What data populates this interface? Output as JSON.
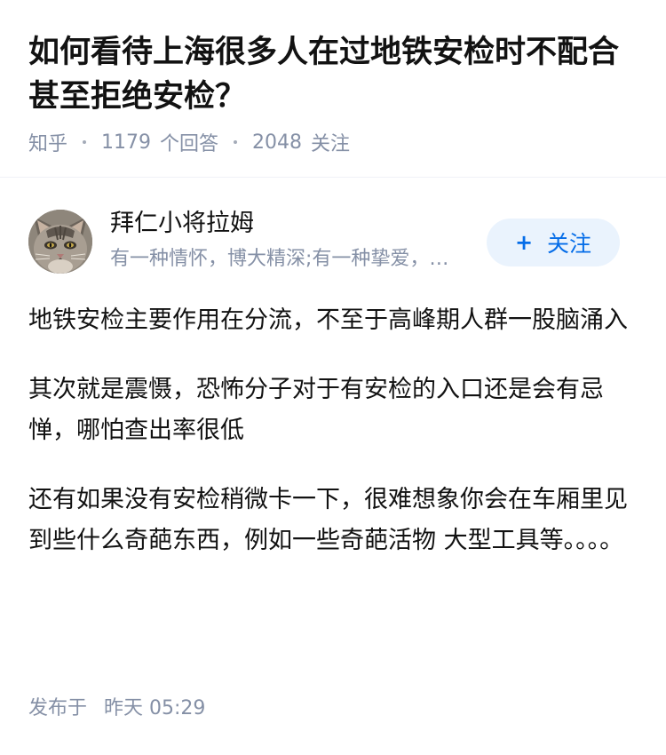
{
  "question": {
    "title": "如何看待上海很多人在过地铁安检时不配合甚至拒绝安检？",
    "source": "知乎",
    "answers_count": "1179",
    "answers_label": "个回答",
    "followers_count": "2048",
    "followers_label": "关注"
  },
  "author": {
    "name": "拜仁小将拉姆",
    "bio": "有一种情怀，博大精深;有一种挚爱，深入骨髓",
    "avatar_icon": "cat-avatar",
    "follow_label": "关注",
    "follow_icon": "plus-icon"
  },
  "answer": {
    "paragraphs": [
      "地铁安检主要作用在分流，不至于高峰期人群一股脑涌入",
      "其次就是震慑，恐怖分子对于有安检的入口还是会有忌惮，哪怕查出率很低",
      "还有如果没有安检稍微卡一下，很难想象你会在车厢里见到些什么奇葩东西，例如一些奇葩活物 大型工具等。。。。"
    ],
    "published_label": "发布于",
    "published_time": "昨天 05:29"
  },
  "colors": {
    "text": "#121212",
    "meta": "#8590a6",
    "accent": "#056de8",
    "follow_bg": "#eaf3fd",
    "divider": "#f0f2f7"
  }
}
